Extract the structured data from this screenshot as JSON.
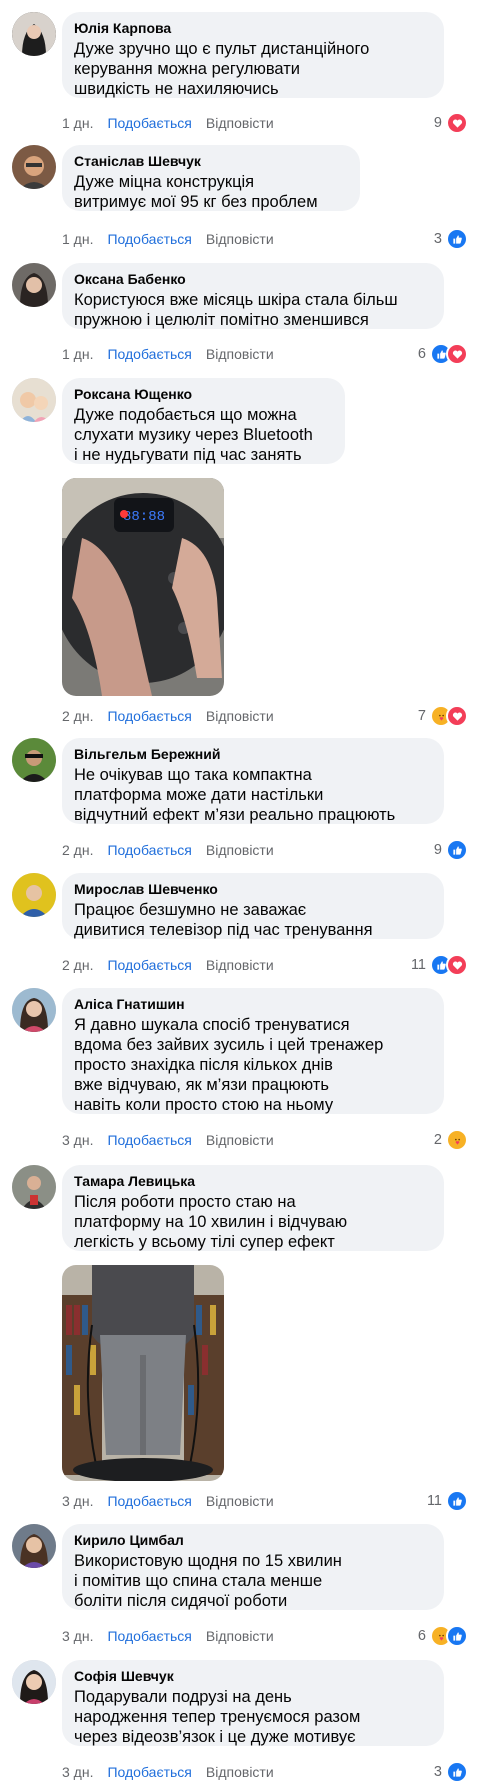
{
  "actions": {
    "like_label": "Подобається",
    "reply_label": "Відповісти"
  },
  "colors": {
    "like_blue": "#1877f2",
    "love_red": "#f33e58",
    "care_yellow": "#f7b125",
    "action_blue": "#216fdb",
    "meta_gray": "#65676b",
    "bubble_bg": "#f0f2f5"
  },
  "comments": [
    {
      "author": "Юлія Карпова",
      "text": "Дуже зручно що є пульт дистанційного\nкерування можна регулювати\nшвидкість не нахиляючись",
      "time": "1 дн.",
      "reactions": [
        "love"
      ],
      "count": "9"
    },
    {
      "author": "Станіслав Шевчук",
      "text": "Дуже міцна конструкція\nвитримує мої 95 кг без проблем",
      "time": "1 дн.",
      "reactions": [
        "like"
      ],
      "count": "3"
    },
    {
      "author": "Оксана Бабенко",
      "text": "Користуюся вже місяць шкіра стала більш\nпружною і целюліт помітно зменшився",
      "time": "1 дн.",
      "reactions": [
        "like",
        "love"
      ],
      "count": "6"
    },
    {
      "author": "Роксана Ющенко",
      "text": "Дуже подобається що можна\nслухати музику через Bluetooth\nі не нудьгувати під час занять",
      "time": "2 дн.",
      "reactions": [
        "care",
        "love"
      ],
      "count": "7",
      "photo": "vibration-platform-feet-photo"
    },
    {
      "author": "Вільгельм Бережний",
      "text": "Не очікував що така компактна\nплатформа може дати настільки\nвідчутний ефект м’язи реально працюють",
      "time": "2 дн.",
      "reactions": [
        "like"
      ],
      "count": "9"
    },
    {
      "author": "Мирослав Шевченко",
      "text": "Працює безшумно не заважає\nдивитися телевізор під час тренування",
      "time": "2 дн.",
      "reactions": [
        "like",
        "love"
      ],
      "count": "11"
    },
    {
      "author": "Аліса Гнатишин",
      "text": "Я давно шукала спосіб тренуватися\nвдома без зайвих зусиль і цей тренажер\nпросто знахідка після кількох днів\nвже відчуваю, як м’язи працюють\nнавіть коли просто стою на ньому",
      "time": "3 дн.",
      "reactions": [
        "care"
      ],
      "count": "2"
    },
    {
      "author": "Тамара Левицька",
      "text": "Після роботи просто стаю на\nплатформу на 10 хвилин і відчуваю\nлегкість у всьому тілі супер ефект",
      "time": "3 дн.",
      "reactions": [
        "like"
      ],
      "count": "11",
      "photo": "woman-on-platform-photo"
    },
    {
      "author": "Кирило Цимбал",
      "text": "Використовую щодня по 15 хвилин\nі помітив що спина стала менше\nболіти після сидячої роботи",
      "time": "3 дн.",
      "reactions": [
        "care",
        "like"
      ],
      "count": "6"
    },
    {
      "author": "Софія Шевчук",
      "text": "Подарували подрузі на день\nнародження тепер тренуємося разом\nчерез відеозв’язок і це дуже мотивує",
      "time": "3 дн.",
      "reactions": [
        "like"
      ],
      "count": "3"
    }
  ]
}
